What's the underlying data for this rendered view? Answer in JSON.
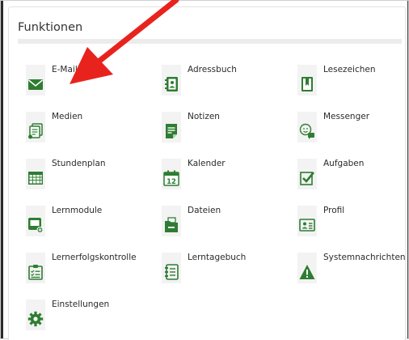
{
  "panel": {
    "title": "Funktionen"
  },
  "accent_color": "#2e7d32",
  "annotation_color": "#e8231e",
  "functions": [
    {
      "label": "E-Mail",
      "icon": "mail-icon"
    },
    {
      "label": "Adressbuch",
      "icon": "address-book-icon"
    },
    {
      "label": "Lesezeichen",
      "icon": "bookmark-icon"
    },
    {
      "label": "Medien",
      "icon": "media-icon"
    },
    {
      "label": "Notizen",
      "icon": "notes-icon"
    },
    {
      "label": "Messenger",
      "icon": "messenger-icon"
    },
    {
      "label": "Stundenplan",
      "icon": "timetable-icon"
    },
    {
      "label": "Kalender",
      "icon": "calendar-icon"
    },
    {
      "label": "Aufgaben",
      "icon": "tasks-icon"
    },
    {
      "label": "Lernmodule",
      "icon": "learning-modules-icon"
    },
    {
      "label": "Dateien",
      "icon": "files-icon"
    },
    {
      "label": "Profil",
      "icon": "profile-icon"
    },
    {
      "label": "Lernerfolgskontrolle",
      "icon": "learning-check-icon"
    },
    {
      "label": "Lerntagebuch",
      "icon": "learning-diary-icon"
    },
    {
      "label": "Systemnachrichten",
      "icon": "system-messages-icon"
    },
    {
      "label": "Einstellungen",
      "icon": "settings-icon"
    }
  ],
  "calendar_day": "12"
}
